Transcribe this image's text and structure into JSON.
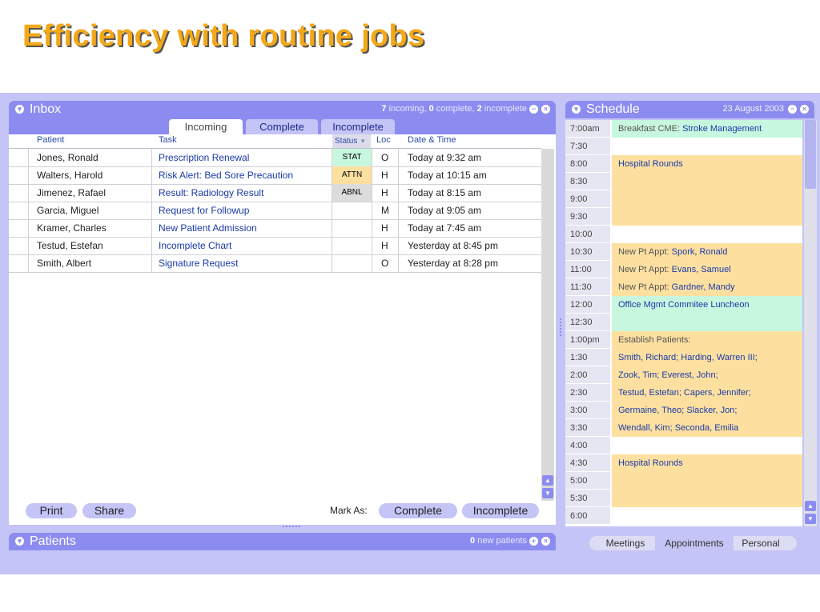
{
  "slide_title": "Efficiency with routine jobs",
  "inbox": {
    "title": "Inbox",
    "summary": {
      "incoming_count": "7",
      "incoming_word": " incoming, ",
      "complete_count": "0",
      "complete_word": " complete, ",
      "incomplete_count": "2",
      "incomplete_word": " incomplete"
    },
    "tabs": [
      "Incoming",
      "Complete",
      "Incomplete"
    ],
    "columns": {
      "patient": "Patient",
      "task": "Task",
      "status": "Status",
      "loc": "Loc",
      "datetime": "Date & Time"
    },
    "rows": [
      {
        "patient": "Jones, Ronald",
        "task": "Prescription Renewal",
        "status": "STAT",
        "loc": "O",
        "datetime": "Today at 9:32 am"
      },
      {
        "patient": "Walters, Harold",
        "task": "Risk Alert: Bed Sore Precaution",
        "status": "ATTN",
        "loc": "H",
        "datetime": "Today at 10:15 am"
      },
      {
        "patient": "Jimenez, Rafael",
        "task": "Result: Radiology Result",
        "status": "ABNL",
        "loc": "H",
        "datetime": "Today at 8:15 am"
      },
      {
        "patient": "Garcia, Miguel",
        "task": "Request for Followup",
        "status": "",
        "loc": "M",
        "datetime": "Today at 9:05 am"
      },
      {
        "patient": "Kramer, Charles",
        "task": "New Patient Admission",
        "status": "",
        "loc": "H",
        "datetime": "Today at 7:45 am"
      },
      {
        "patient": "Testud, Estefan",
        "task": "Incomplete Chart",
        "status": "",
        "loc": "H",
        "datetime": "Yesterday at 8:45 pm"
      },
      {
        "patient": "Smith, Albert",
        "task": "Signature Request",
        "status": "",
        "loc": "O",
        "datetime": "Yesterday at 8:28 pm"
      }
    ],
    "buttons": {
      "print": "Print",
      "share": "Share",
      "mark_as": "Mark As:",
      "complete": "Complete",
      "incomplete": "Incomplete"
    }
  },
  "patients": {
    "title": "Patients",
    "count": "0",
    "count_label": " new patients"
  },
  "schedule": {
    "title": "Schedule",
    "date": "23 August 2003",
    "rows": [
      {
        "time": "7:00am",
        "prefix": "Breakfast CME: ",
        "name": "Stroke Management",
        "color": "#c8f7df"
      },
      {
        "time": "7:30",
        "prefix": "",
        "name": "",
        "color": "#ffffff"
      },
      {
        "time": "8:00",
        "prefix": "",
        "name": "Hospital Rounds",
        "color": "#fde0a0"
      },
      {
        "time": "8:30",
        "prefix": "",
        "name": "",
        "color": "#fde0a0"
      },
      {
        "time": "9:00",
        "prefix": "",
        "name": "",
        "color": "#fde0a0"
      },
      {
        "time": "9:30",
        "prefix": "",
        "name": "",
        "color": "#fde0a0"
      },
      {
        "time": "10:00",
        "prefix": "",
        "name": "",
        "color": "#ffffff"
      },
      {
        "time": "10:30",
        "prefix": "New Pt Appt: ",
        "name": "Spork, Ronald",
        "color": "#fde0a0"
      },
      {
        "time": "11:00",
        "prefix": "New Pt Appt: ",
        "name": "Evans, Samuel",
        "color": "#fde0a0"
      },
      {
        "time": "11:30",
        "prefix": "New Pt Appt: ",
        "name": "Gardner, Mandy",
        "color": "#fde0a0"
      },
      {
        "time": "12:00",
        "prefix": "",
        "name": "Office Mgmt Commitee Luncheon",
        "color": "#c8f7df"
      },
      {
        "time": "12:30",
        "prefix": "",
        "name": "",
        "color": "#c8f7df"
      },
      {
        "time": "1:00pm",
        "prefix": "Establish Patients:",
        "name": "",
        "color": "#fde0a0"
      },
      {
        "time": "1:30",
        "prefix": "",
        "name": "Smith, Richard; Harding, Warren III;",
        "color": "#fde0a0"
      },
      {
        "time": "2:00",
        "prefix": "",
        "name": "Zook, Tim; Everest, John;",
        "color": "#fde0a0"
      },
      {
        "time": "2:30",
        "prefix": "",
        "name": "Testud, Estefan; Capers, Jennifer;",
        "color": "#fde0a0"
      },
      {
        "time": "3:00",
        "prefix": "",
        "name": "Germaine, Theo; Slacker, Jon;",
        "color": "#fde0a0"
      },
      {
        "time": "3:30",
        "prefix": "",
        "name": "Wendall, Kim; Seconda, Emilia",
        "color": "#fde0a0"
      },
      {
        "time": "4:00",
        "prefix": "",
        "name": "",
        "color": "#ffffff"
      },
      {
        "time": "4:30",
        "prefix": "",
        "name": "Hospital Rounds",
        "color": "#fde0a0"
      },
      {
        "time": "5:00",
        "prefix": "",
        "name": "",
        "color": "#fde0a0"
      },
      {
        "time": "5:30",
        "prefix": "",
        "name": "",
        "color": "#fde0a0"
      },
      {
        "time": "6:00",
        "prefix": "",
        "name": "",
        "color": "#ffffff"
      }
    ],
    "tabs": [
      "Meetings",
      "Appointments",
      "Personal"
    ]
  },
  "colors": {
    "accent": "#8c8cf0",
    "app_background": "#c4c4f6",
    "title": "#f4a818",
    "stat": "#c8f7df",
    "attn": "#fde0a0",
    "abnl": "#dcdcdc"
  },
  "icons": [
    "collapse-circle-icon",
    "minus-circle-icon",
    "close-circle-icon",
    "plus-circle-icon",
    "scroll-up-icon",
    "scroll-down-icon",
    "sort-down-icon"
  ]
}
